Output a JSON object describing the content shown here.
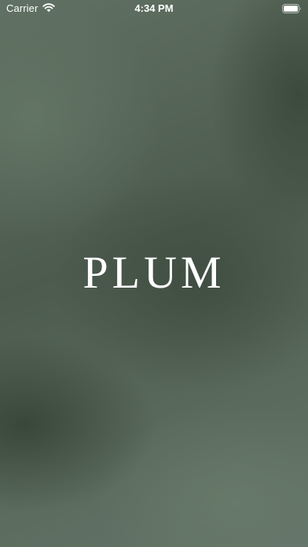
{
  "status_bar": {
    "carrier": "Carrier",
    "time": "4:34 PM",
    "wifi_icon": "wifi-icon",
    "battery_icon": "battery-full-icon"
  },
  "splash": {
    "logo_text": "PLUM",
    "background_colors": [
      "#607062",
      "#4c5b4e",
      "#3e4c40",
      "#687a6a"
    ],
    "logo_color": "#ffffff"
  }
}
